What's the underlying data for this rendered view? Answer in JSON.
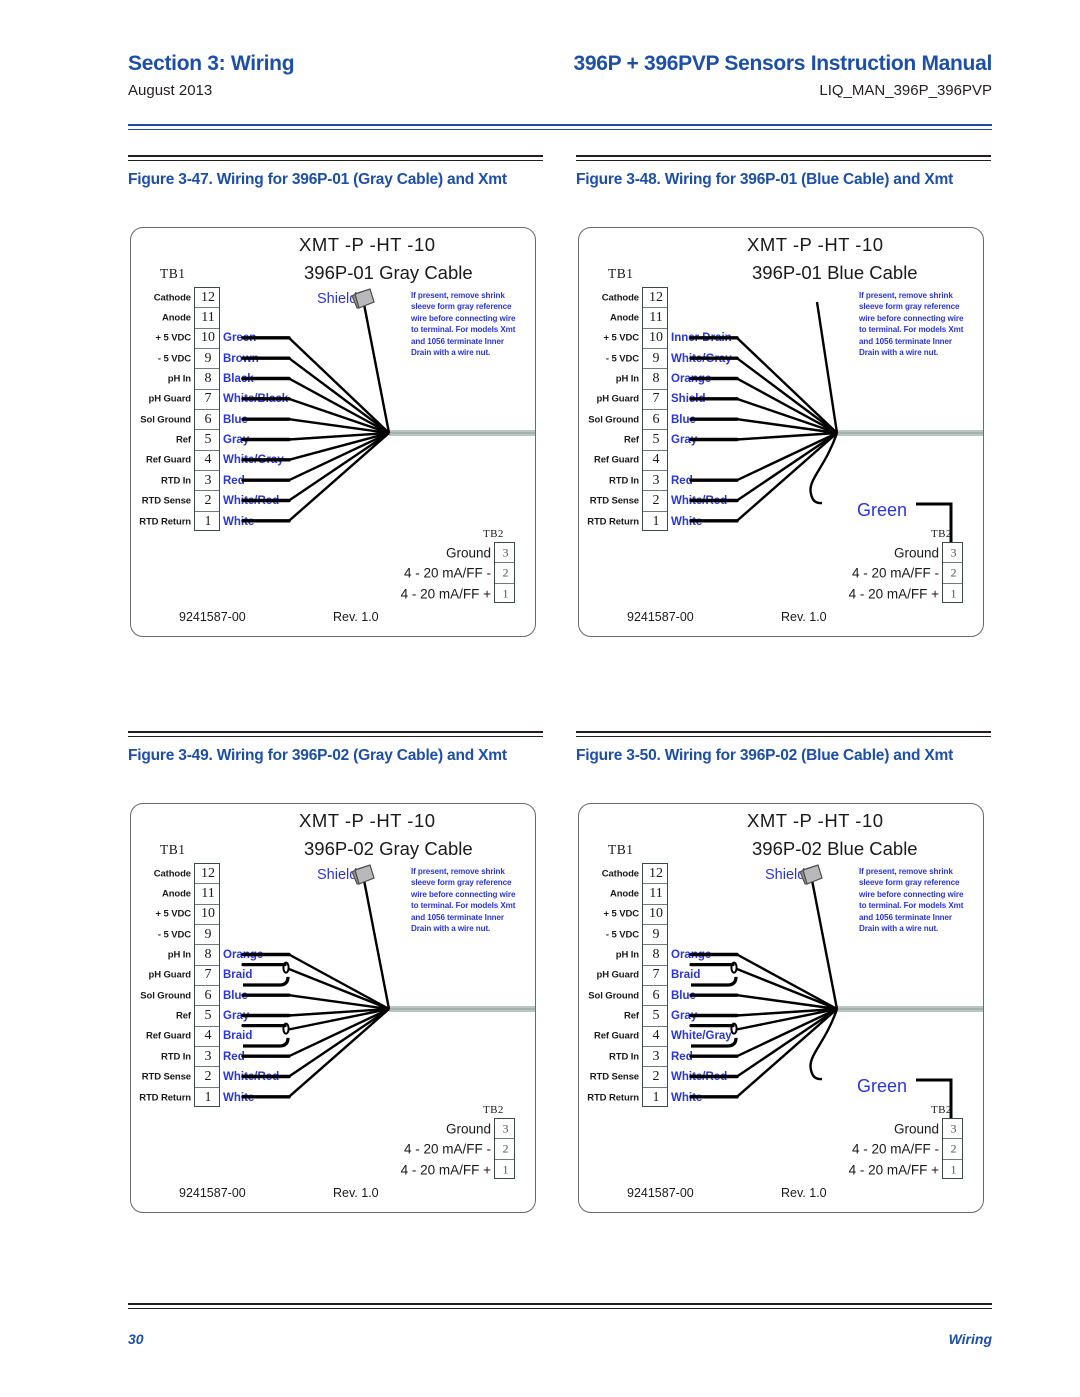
{
  "header": {
    "section_title": "Section 3: Wiring",
    "date": "August 2013",
    "manual_title": "396P + 396PVP Sensors Instruction Manual",
    "doc_code": "LIQ_MAN_396P_396PVP"
  },
  "footer": {
    "page_number": "30",
    "section_label": "Wiring"
  },
  "colors": {
    "brand_blue": "#1d4fa8",
    "wire_label_blue": "#2b36d8",
    "text_black": "#231f20"
  },
  "common": {
    "tb1_label": "TB1",
    "tb2_label": "TB2",
    "title_line1": "XMT  -P  -HT -10",
    "note_text": "If present, remove shrink sleeve form gray reference wire before connecting wire to terminal.  For models Xmt and 1056 terminate Inner Drain with a wire nut.",
    "shield_label": "Shield",
    "green_label": "Green",
    "part_number": "9241587-00",
    "revision": "Rev. 1.0",
    "tb1_functions": [
      "Cathode",
      "Anode",
      "+ 5 VDC",
      "- 5 VDC",
      "pH In",
      "pH Guard",
      "Sol Ground",
      "Ref",
      "Ref Guard",
      "RTD In",
      "RTD Sense",
      "RTD Return"
    ],
    "tb1_numbers": [
      "12",
      "11",
      "10",
      "9",
      "8",
      "7",
      "6",
      "5",
      "4",
      "3",
      "2",
      "1"
    ],
    "tb2_functions": [
      "Ground",
      "4 - 20 mA/FF -",
      "4 - 20 mA/FF +"
    ],
    "tb2_numbers": [
      "3",
      "2",
      "1"
    ]
  },
  "figures": [
    {
      "caption": "Figure 3-47. Wiring for 396P-01 (Gray Cable) and Xmt",
      "title_line2": "396P-01 Gray Cable",
      "has_shield_label": true,
      "has_green_wire": false,
      "wire_names": [
        "",
        "",
        "Green",
        "Brown",
        "Black",
        "White/Black",
        "Blue",
        "Gray",
        "White/Gray",
        "Red",
        "White/Red",
        "White"
      ]
    },
    {
      "caption": "Figure 3-48. Wiring for 396P-01 (Blue Cable) and Xmt",
      "title_line2": "396P-01 Blue Cable",
      "has_shield_label": false,
      "has_green_wire": true,
      "wire_names": [
        "",
        "",
        "Inner Drain",
        "White/Gray",
        "Orange",
        "Shield",
        "Blue",
        "Gray",
        "",
        "Red",
        "White/Red",
        "White"
      ]
    },
    {
      "caption": "Figure 3-49. Wiring for 396P-02 (Gray Cable) and Xmt",
      "title_line2": "396P-02 Gray Cable",
      "has_shield_label": true,
      "has_green_wire": false,
      "wire_names": [
        "",
        "",
        "",
        "",
        "Orange",
        "Braid",
        "Blue",
        "Gray",
        "Braid",
        "Red",
        "White/Red",
        "White"
      ]
    },
    {
      "caption": "Figure 3-50. Wiring for 396P-02 (Blue Cable) and Xmt",
      "title_line2": "396P-02 Blue Cable",
      "has_shield_label": true,
      "has_green_wire": true,
      "wire_names": [
        "",
        "",
        "",
        "",
        "Orange",
        "Braid",
        "Blue",
        "Gray",
        "White/Gray",
        "Red",
        "White/Red",
        "White"
      ]
    }
  ]
}
